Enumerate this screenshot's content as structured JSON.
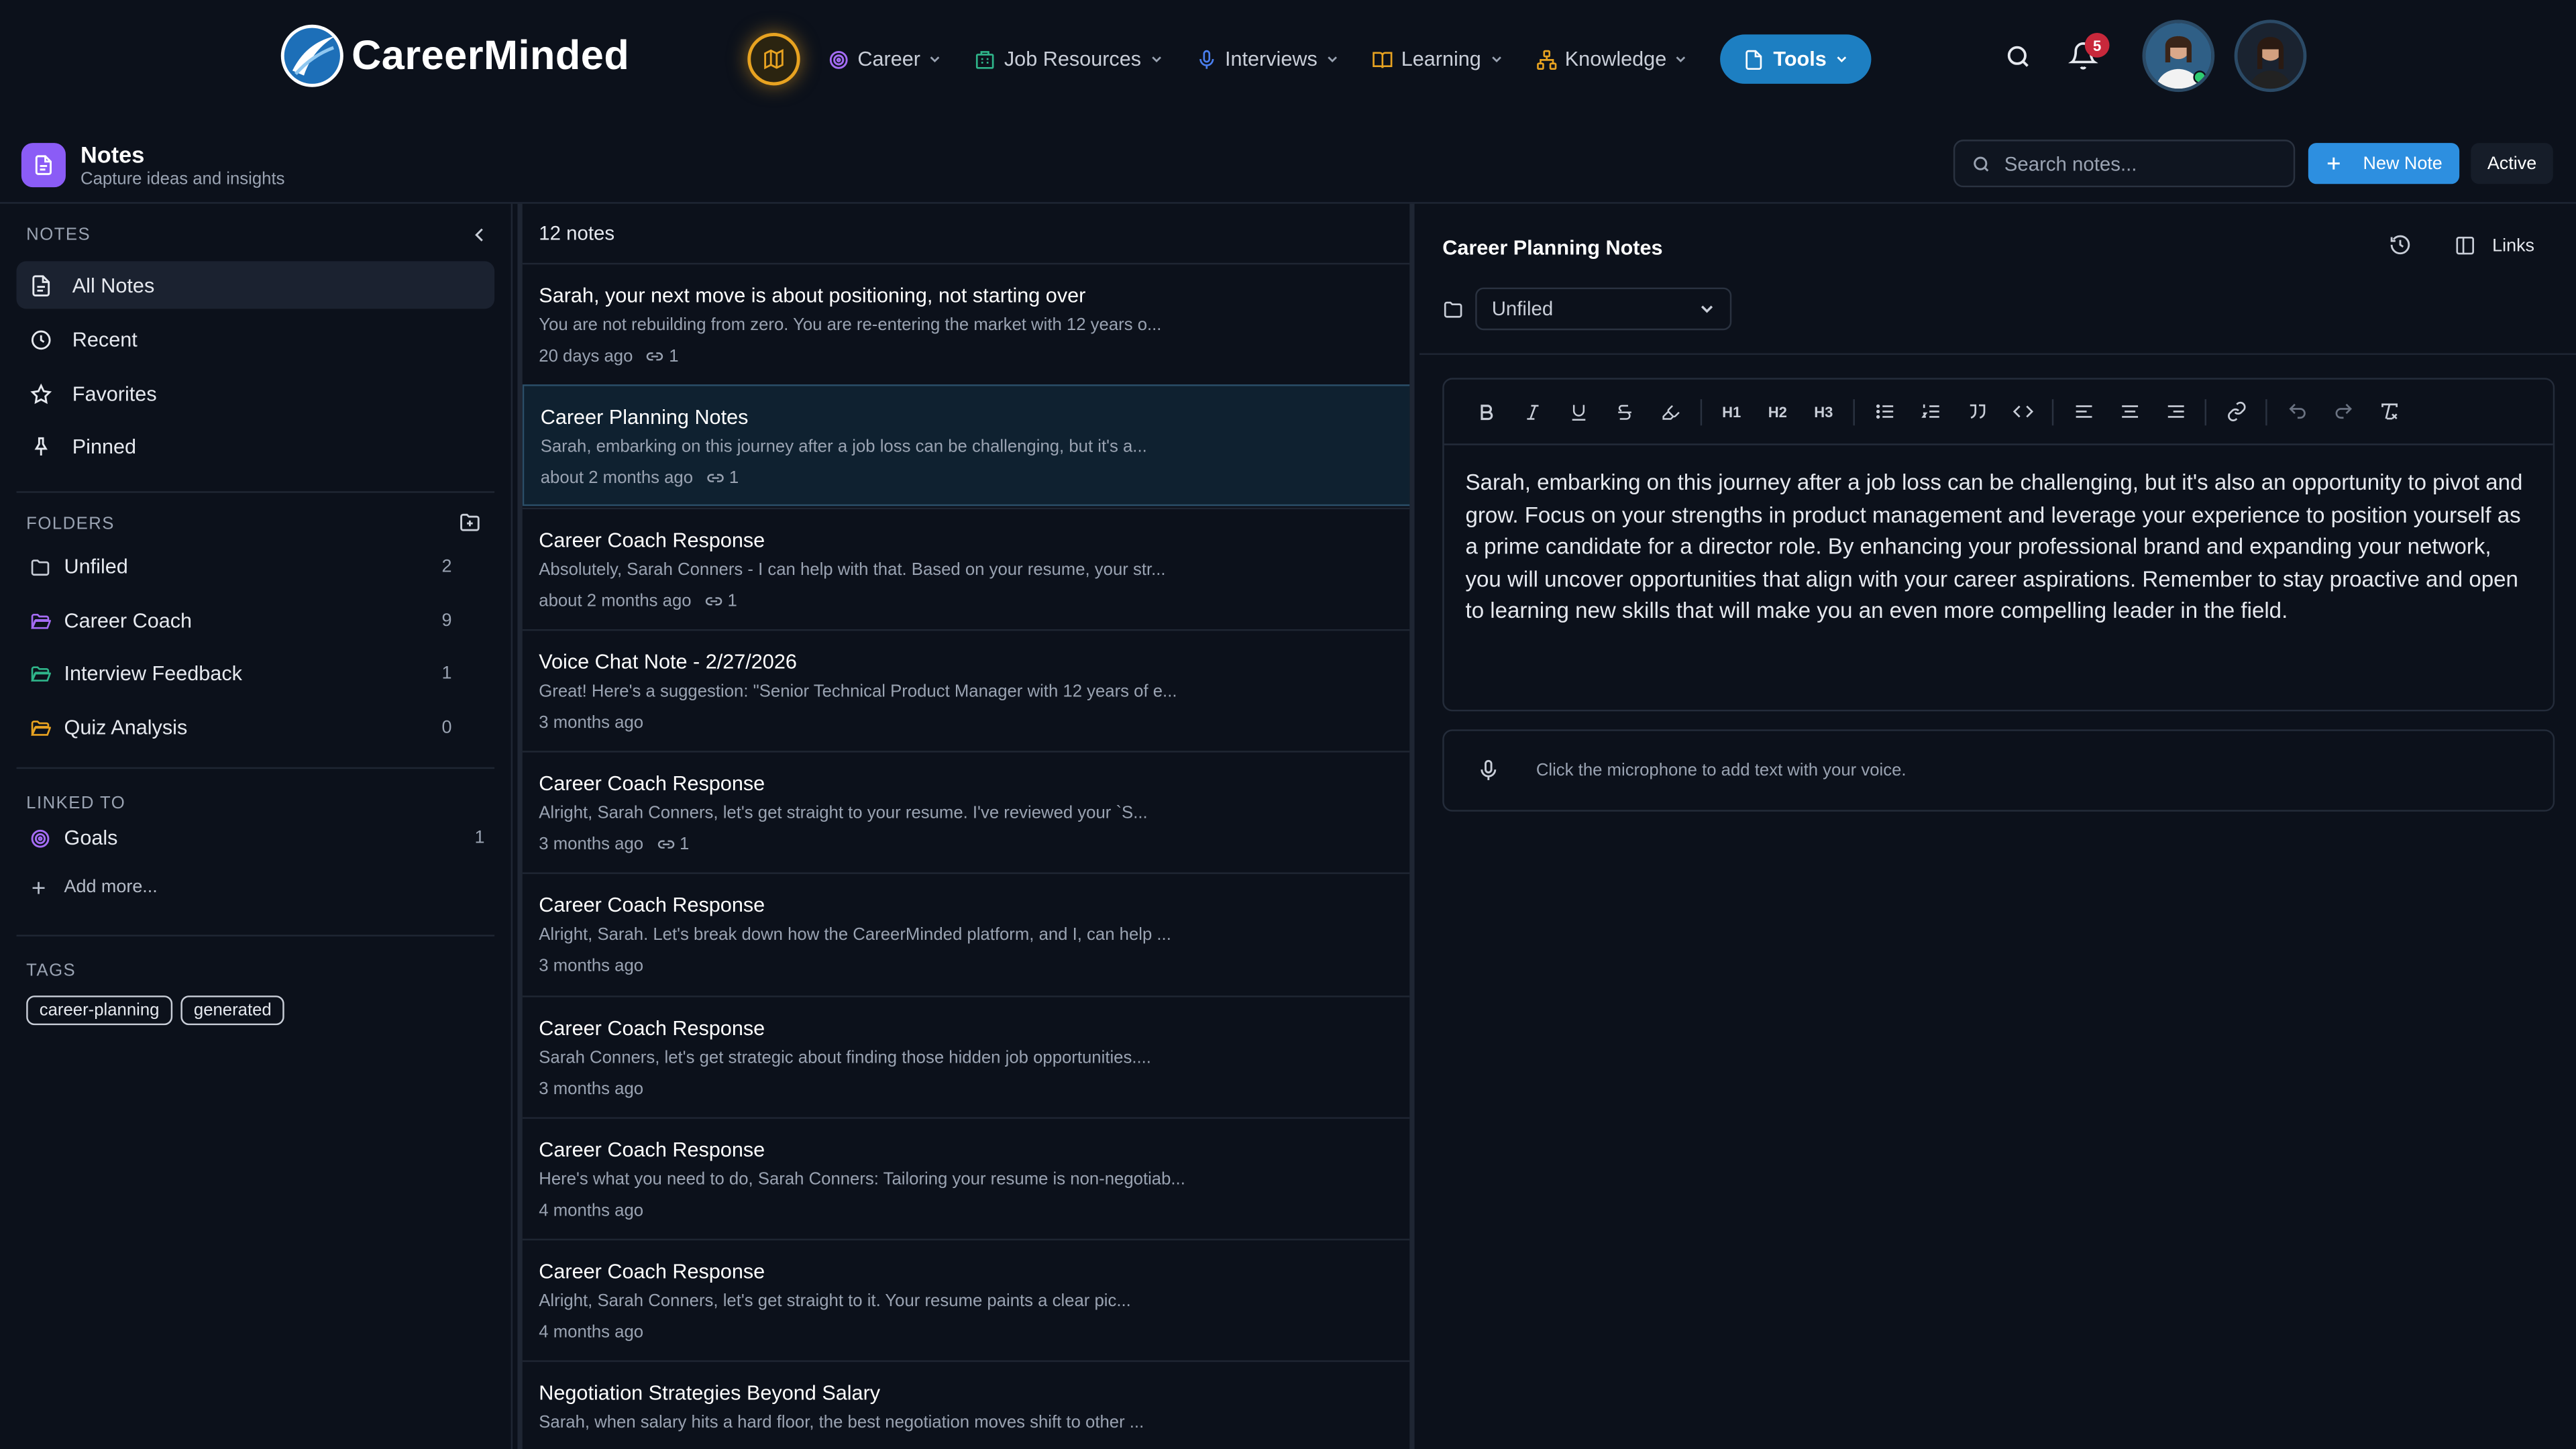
{
  "brand": {
    "name": "CareerMinded"
  },
  "nav": {
    "items": [
      {
        "label": "Career",
        "icon": "target-icon",
        "color": "#a56cf5"
      },
      {
        "label": "Job Resources",
        "icon": "building-icon",
        "color": "#2fb58a"
      },
      {
        "label": "Interviews",
        "icon": "microphone-icon",
        "color": "#4a7ff0"
      },
      {
        "label": "Learning",
        "icon": "book-icon",
        "color": "#e8a321"
      },
      {
        "label": "Knowledge",
        "icon": "network-icon",
        "color": "#e8a321"
      }
    ],
    "active": {
      "label": "Tools"
    },
    "notifications": "5"
  },
  "header": {
    "title": "Notes",
    "subtitle": "Capture ideas and insights",
    "search_placeholder": "Search notes...",
    "new_note": "New Note",
    "active": "Active"
  },
  "sidebar": {
    "notes_label": "NOTES",
    "nav": [
      {
        "label": "All Notes"
      },
      {
        "label": "Recent"
      },
      {
        "label": "Favorites"
      },
      {
        "label": "Pinned"
      }
    ],
    "folders_label": "FOLDERS",
    "folders": [
      {
        "label": "Unfiled",
        "count": "2",
        "color": "#c9ced8"
      },
      {
        "label": "Career Coach",
        "count": "9",
        "color": "#a56cf5"
      },
      {
        "label": "Interview Feedback",
        "count": "1",
        "color": "#2fb58a"
      },
      {
        "label": "Quiz Analysis",
        "count": "0",
        "color": "#e8a321"
      }
    ],
    "linked_label": "LINKED TO",
    "linked": [
      {
        "label": "Goals",
        "count": "1"
      }
    ],
    "add_more": "Add more...",
    "tags_label": "TAGS",
    "tags": [
      "career-planning",
      "generated"
    ]
  },
  "notelist": {
    "count": "12 notes",
    "notes": [
      {
        "title": "Sarah, your next move is about positioning, not starting over",
        "preview": "You are not rebuilding from zero. You are re-entering the market with 12 years o...",
        "time": "20 days ago",
        "links": "1"
      },
      {
        "title": "Career Planning Notes",
        "preview": "Sarah, embarking on this journey after a job loss can be challenging, but it's a...",
        "time": "about 2 months ago",
        "links": "1"
      },
      {
        "title": "Career Coach Response",
        "preview": "Absolutely, Sarah Conners - I can help with that. Based on your resume, your str...",
        "time": "about 2 months ago",
        "links": "1"
      },
      {
        "title": "Voice Chat Note - 2/27/2026",
        "preview": "Great! Here's a suggestion: \"Senior Technical Product Manager with 12 years of e...",
        "time": "3 months ago",
        "links": ""
      },
      {
        "title": "Career Coach Response",
        "preview": "Alright, Sarah Conners, let's get straight to your resume. I've reviewed your `S...",
        "time": "3 months ago",
        "links": "1"
      },
      {
        "title": "Career Coach Response",
        "preview": "Alright, Sarah. Let's break down how the CareerMinded platform, and I, can help ...",
        "time": "3 months ago",
        "links": ""
      },
      {
        "title": "Career Coach Response",
        "preview": "Sarah Conners, let's get strategic about finding those hidden job opportunities....",
        "time": "3 months ago",
        "links": ""
      },
      {
        "title": "Career Coach Response",
        "preview": "Here's what you need to do, Sarah Conners: Tailoring your resume is non-negotiab...",
        "time": "4 months ago",
        "links": ""
      },
      {
        "title": "Career Coach Response",
        "preview": "Alright, Sarah Conners, let's get straight to it. Your resume paints a clear pic...",
        "time": "4 months ago",
        "links": ""
      },
      {
        "title": "Negotiation Strategies Beyond Salary",
        "preview": "Sarah, when salary hits a hard floor, the best negotiation moves shift to other ...",
        "time": "",
        "links": ""
      }
    ]
  },
  "editor": {
    "title": "Career Planning Notes",
    "links_label": "Links",
    "folder": "Unfiled",
    "toolbar": {
      "h1": "H1",
      "h2": "H2",
      "h3": "H3"
    },
    "content": "Sarah, embarking on this journey after a job loss can be challenging, but it's also an opportunity to pivot and grow. Focus on your strengths in product management and leverage your experience to position yourself as a prime candidate for a director role. By enhancing your professional brand and expanding your network, you will uncover opportunities that align with your career aspirations. Remember to stay proactive and open to learning new skills that will make you an even more compelling leader in the field.",
    "voice_hint": "Click the microphone to add text with your voice."
  }
}
